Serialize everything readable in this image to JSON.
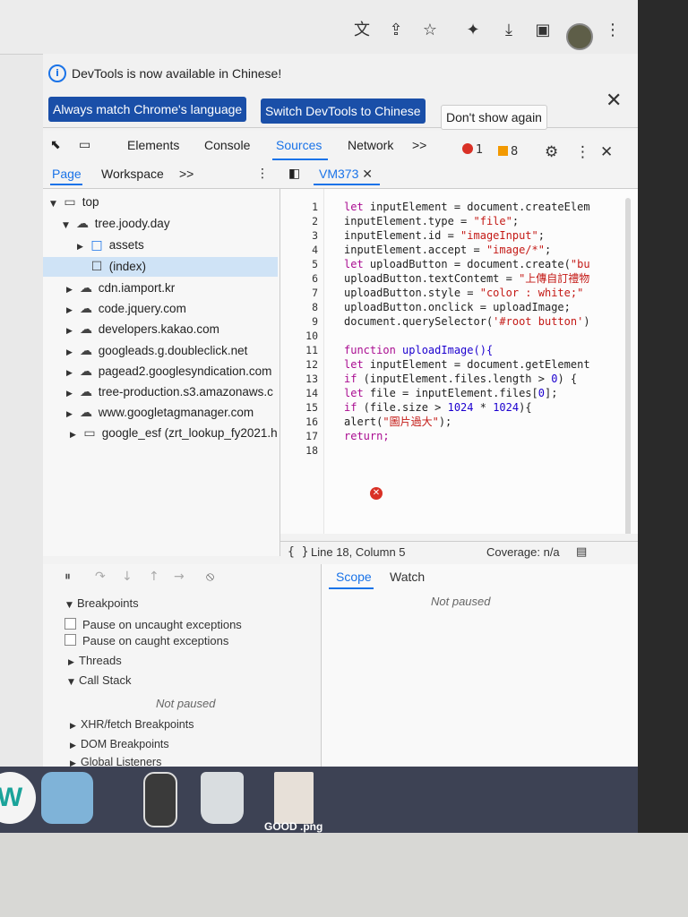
{
  "browser": {
    "toolbar_icons": [
      "translate-icon",
      "share-icon",
      "star-icon",
      "extensions-icon",
      "download-icon",
      "sidepanel-icon",
      "profile-avatar",
      "more-icon"
    ]
  },
  "infobar": {
    "message": "DevTools is now available in Chinese!",
    "btn_match": "Always match Chrome's language",
    "btn_switch": "Switch DevTools to Chinese",
    "btn_dont_show": "Don't show again"
  },
  "devtools_tabs": {
    "elements": "Elements",
    "console": "Console",
    "sources": "Sources",
    "network": "Network",
    "more": ">>",
    "errors": "1",
    "warnings": "8"
  },
  "sources_nav": {
    "page": "Page",
    "workspace": "Workspace",
    "more": ">>",
    "file_tab": "VM373"
  },
  "tree": {
    "top": "top",
    "domain": "tree.joody.day",
    "assets": "assets",
    "index": "(index)",
    "items": [
      "cdn.iamport.kr",
      "code.jquery.com",
      "developers.kakao.com",
      "googleads.g.doubleclick.net",
      "pagead2.googlesyndication.com",
      "tree-production.s3.amazonaws.c",
      "www.googletagmanager.com",
      "google_esf (zrt_lookup_fy2021.h"
    ]
  },
  "code": {
    "line_numbers": [
      "1",
      "2",
      "3",
      "4",
      "5",
      "6",
      "7",
      "8",
      "9",
      "10",
      "11",
      "12",
      "13",
      "14",
      "15",
      "16",
      "17",
      "18"
    ],
    "l1a": "let",
    "l1b": " inputElement = document.createElem",
    "l2a": "inputElement.type = ",
    "l2b": "\"file\"",
    "l2c": ";",
    "l3a": "inputElement.id = ",
    "l3b": "\"imageInput\"",
    "l3c": ";",
    "l4a": "inputElement.accept = ",
    "l4b": "\"image/*\"",
    "l4c": ";",
    "l5a": "let",
    "l5b": " uploadButton = document.create(",
    "l5c": "\"bu",
    "l6a": "uploadButton.textContemt = ",
    "l6b": "\"上傳自訂禮物",
    "l7a": "uploadButton.style = ",
    "l7b": "\"color : white;\"",
    "l8": "uploadButton.onclick = uploadImage;",
    "l9a": "document.querySelector(",
    "l9b": "'#root button'",
    "l9c": ")",
    "l11a": "function",
    "l11b": " uploadImage(){",
    "l12a": "let",
    "l12b": " inputElement = document.getElement",
    "l13a": "if",
    "l13b": " (inputElement.files.length > ",
    "l13c": "0",
    "l13d": ") {",
    "l14a": "let",
    "l14b": " file = inputElement.files[",
    "l14c": "0",
    "l14d": "];",
    "l15a": "if",
    "l15b": " (file.size > ",
    "l15c": "1024",
    "l15d": " * ",
    "l15e": "1024",
    "l15f": "){",
    "l16a": "alert(",
    "l16b": "\"圖片過大\"",
    "l16c": ");",
    "l17": "return;"
  },
  "status": {
    "position": "Line 18, Column 5",
    "coverage": "Coverage: n/a",
    "braces": "{ }"
  },
  "debugger": {
    "breakpoints": "Breakpoints",
    "pause_uncaught": "Pause on uncaught exceptions",
    "pause_caught": "Pause on caught exceptions",
    "threads": "Threads",
    "call_stack": "Call Stack",
    "not_paused": "Not paused",
    "xhr": "XHR/fetch Breakpoints",
    "dom": "DOM Breakpoints",
    "global": "Global Listeners"
  },
  "scope": {
    "scope_tab": "Scope",
    "watch_tab": "Watch",
    "not_paused": "Not paused"
  },
  "dock": {
    "file_label": "GOOD .png"
  }
}
